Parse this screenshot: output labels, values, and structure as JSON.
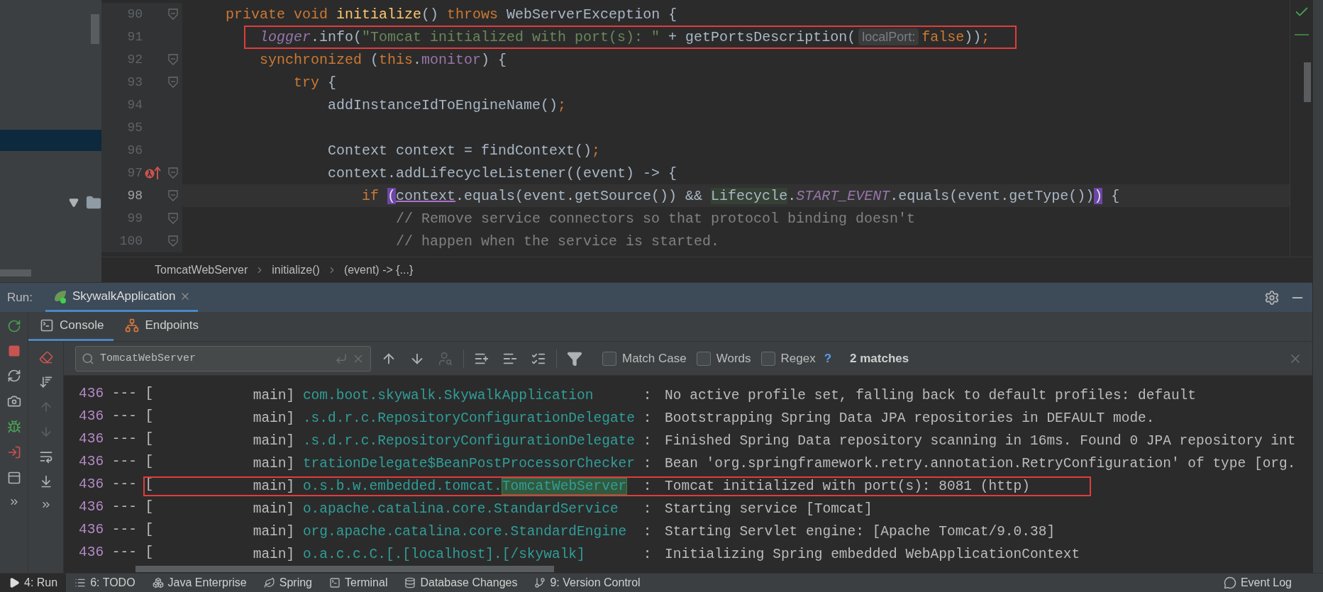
{
  "project_panel": {
    "rows": [
      {
        "kind": "blank",
        "selected": true
      },
      {
        "kind": "folder",
        "selected": false,
        "expanded": true
      }
    ]
  },
  "code": {
    "lines": [
      {
        "number": "90",
        "foldable": true,
        "current": false,
        "boxed": false,
        "tokens": [
          {
            "kind": "keyword",
            "text": "private void "
          },
          {
            "kind": "method_decl",
            "text": "initialize"
          },
          {
            "kind": "plain",
            "text": "() "
          },
          {
            "kind": "keyword",
            "text": "throws"
          },
          {
            "kind": "plain",
            "text": " WebServerException {"
          }
        ],
        "children": [
          {
            "number": "91",
            "foldable": false,
            "current": false,
            "boxed": true,
            "tokens": [
              {
                "kind": "field_italic",
                "text": "logger"
              },
              {
                "kind": "plain",
                "text": ".info("
              },
              {
                "kind": "string",
                "text": "\"Tomcat initialized with port(s): \""
              },
              {
                "kind": "plain",
                "text": " + getPortsDescription("
              },
              {
                "kind": "hint",
                "text": "localPort:"
              },
              {
                "kind": "keyword",
                "text": "false"
              },
              {
                "kind": "plain",
                "text": "))"
              },
              {
                "kind": "keyword",
                "text": ";"
              }
            ]
          },
          {
            "number": "92",
            "foldable": true,
            "current": false,
            "boxed": false,
            "tokens": [
              {
                "kind": "keyword",
                "text": "synchronized"
              },
              {
                "kind": "plain",
                "text": " ("
              },
              {
                "kind": "keyword",
                "text": "this"
              },
              {
                "kind": "plain",
                "text": "."
              },
              {
                "kind": "field",
                "text": "monitor"
              },
              {
                "kind": "plain",
                "text": ") {"
              }
            ],
            "children": [
              {
                "number": "93",
                "foldable": true,
                "current": false,
                "boxed": false,
                "tokens": [
                  {
                    "kind": "keyword",
                    "text": "try"
                  },
                  {
                    "kind": "plain",
                    "text": " {"
                  }
                ],
                "children": [
                  {
                    "number": "94",
                    "foldable": false,
                    "current": false,
                    "boxed": false,
                    "tokens": [
                      {
                        "kind": "plain",
                        "text": "addInstanceIdToEngineName()"
                      },
                      {
                        "kind": "keyword",
                        "text": ";"
                      }
                    ]
                  },
                  {
                    "number": "95",
                    "foldable": false,
                    "current": false
                  },
                  {
                    "number": "96",
                    "foldable": false,
                    "current": false,
                    "boxed": false,
                    "tokens": [
                      {
                        "kind": "plain",
                        "text": "Context context = findContext()"
                      },
                      {
                        "kind": "keyword",
                        "text": ";"
                      }
                    ]
                  },
                  {
                    "number": "97",
                    "foldable": true,
                    "current": false,
                    "boxed": false,
                    "kind": "lambda",
                    "tokens": [
                      {
                        "kind": "plain",
                        "text": "context.addLifecycleListener((event) -> {"
                      }
                    ],
                    "children": [
                      {
                        "number": "98",
                        "foldable": true,
                        "current": true,
                        "boxed": false,
                        "tokens": [
                          {
                            "kind": "keyword",
                            "text": "if "
                          },
                          {
                            "kind": "brace",
                            "text": "("
                          },
                          {
                            "kind": "captured",
                            "text": "context"
                          },
                          {
                            "kind": "plain",
                            "text": ".equals(event.getSource()) && "
                          },
                          {
                            "kind": "usage",
                            "text": "Lifecycle"
                          },
                          {
                            "kind": "plain",
                            "text": "."
                          },
                          {
                            "kind": "static",
                            "text": "START_EVENT"
                          },
                          {
                            "kind": "plain",
                            "text": ".equals(event.getType())"
                          },
                          {
                            "kind": "brace",
                            "text": ")"
                          },
                          {
                            "kind": "plain",
                            "text": " {"
                          }
                        ],
                        "children": [
                          {
                            "number": "99",
                            "foldable": true,
                            "current": false,
                            "boxed": false,
                            "tokens": [
                              {
                                "kind": "comment",
                                "text": "// Remove service connectors so that protocol binding doesn't"
                              }
                            ]
                          },
                          {
                            "number": "100",
                            "foldable": true,
                            "current": false,
                            "boxed": false,
                            "tokens": [
                              {
                                "kind": "comment",
                                "text": "// happen when the service is started."
                              }
                            ]
                          }
                        ]
                      }
                    ]
                  }
                ]
              }
            ]
          }
        ]
      }
    ]
  },
  "breadcrumbs": [
    "TomcatWebServer",
    "initialize()",
    "(event) -> {...}"
  ],
  "run": {
    "label": "Run:",
    "tabs": [
      {
        "label": "SkywalkApplication",
        "selected": true
      }
    ]
  },
  "run_toolbar": [
    {
      "kind": "rerun"
    },
    {
      "kind": "stop"
    },
    {
      "kind": "restore"
    },
    {
      "kind": "screenshot"
    },
    {
      "kind": "debug"
    },
    {
      "kind": "exit"
    },
    {
      "kind": "layout"
    },
    {
      "kind": "more"
    }
  ],
  "console_tabs": [
    {
      "label": "Console",
      "kind": "console",
      "selected": true
    },
    {
      "label": "Endpoints",
      "kind": "endpoints",
      "selected": false
    }
  ],
  "side_toolbar": [
    {
      "kind": "eraser",
      "disabled": false
    },
    {
      "kind": "sort",
      "disabled": false
    },
    {
      "kind": "up",
      "disabled": true
    },
    {
      "kind": "down",
      "disabled": true
    },
    {
      "kind": "wrap",
      "disabled": false
    },
    {
      "kind": "scroll-end",
      "disabled": false
    },
    {
      "kind": "more",
      "disabled": false
    }
  ],
  "search": {
    "value": "TomcatWebServer",
    "tools": [
      {
        "kind": "up",
        "disabled": false
      },
      {
        "kind": "down",
        "disabled": false
      },
      {
        "kind": "usage",
        "disabled": true
      },
      {
        "kind": "add",
        "disabled": false
      },
      {
        "kind": "remove",
        "disabled": false
      },
      {
        "kind": "select",
        "disabled": false
      },
      {
        "kind": "filter",
        "disabled": false
      }
    ],
    "options": [
      {
        "label": "Match Case",
        "checked": false
      },
      {
        "label": "Words",
        "checked": false
      },
      {
        "label": "Regex",
        "checked": false
      }
    ],
    "help": "?",
    "matches": "2 matches"
  },
  "console": {
    "rows": [
      {
        "pid": "436",
        "sep": "--- [",
        "thread": "main]",
        "logger": [
          {
            "text": "com.boot.skywalk.SkywalkApplication",
            "match": false
          }
        ],
        "colon": ":",
        "message": "No active profile set, falling back to default profiles: default",
        "boxed": false
      },
      {
        "pid": "436",
        "sep": "--- [",
        "thread": "main]",
        "logger": [
          {
            "text": ".s.d.r.c.RepositoryConfigurationDelegate",
            "match": false
          }
        ],
        "colon": ":",
        "message": "Bootstrapping Spring Data JPA repositories in DEFAULT mode.",
        "boxed": false
      },
      {
        "pid": "436",
        "sep": "--- [",
        "thread": "main]",
        "logger": [
          {
            "text": ".s.d.r.c.RepositoryConfigurationDelegate",
            "match": false
          }
        ],
        "colon": ":",
        "message": "Finished Spring Data repository scanning in 16ms. Found 0 JPA repository int",
        "boxed": false
      },
      {
        "pid": "436",
        "sep": "--- [",
        "thread": "main]",
        "logger": [
          {
            "text": "trationDelegate$BeanPostProcessorChecker",
            "match": false
          }
        ],
        "colon": ":",
        "message": "Bean 'org.springframework.retry.annotation.RetryConfiguration' of type [org.",
        "boxed": false
      },
      {
        "pid": "436",
        "sep": "--- [",
        "thread": "main]",
        "logger": [
          {
            "text": "o.s.b.w.embedded.tomcat.",
            "match": false
          },
          {
            "text": "TomcatWebServer",
            "match": true
          }
        ],
        "colon": ":",
        "message": "Tomcat initialized with port(s): 8081 (http)",
        "boxed": true
      },
      {
        "pid": "436",
        "sep": "--- [",
        "thread": "main]",
        "logger": [
          {
            "text": "o.apache.catalina.core.StandardService",
            "match": false
          }
        ],
        "colon": ":",
        "message": "Starting service [Tomcat]",
        "boxed": false
      },
      {
        "pid": "436",
        "sep": "--- [",
        "thread": "main]",
        "logger": [
          {
            "text": "org.apache.catalina.core.StandardEngine",
            "match": false
          }
        ],
        "colon": ":",
        "message": "Starting Servlet engine: [Apache Tomcat/9.0.38]",
        "boxed": false
      },
      {
        "pid": "436",
        "sep": "--- [",
        "thread": "main]",
        "logger": [
          {
            "text": "o.a.c.c.C.[.[localhost].[/skywalk]",
            "match": false
          }
        ],
        "colon": ":",
        "message": "Initializing Spring embedded WebApplicationContext",
        "boxed": false
      }
    ]
  },
  "status_bar": {
    "items": [
      {
        "label": "4: Run",
        "kind": "run",
        "selected": true
      },
      {
        "label": "6: TODO",
        "kind": "todo",
        "selected": false
      },
      {
        "label": "Java Enterprise",
        "kind": "enterprise",
        "selected": false
      },
      {
        "label": "Spring",
        "kind": "spring",
        "selected": false
      },
      {
        "label": "Terminal",
        "kind": "terminal",
        "selected": false
      },
      {
        "label": "Database Changes",
        "kind": "database",
        "selected": false
      },
      {
        "label": "9: Version Control",
        "kind": "vcs",
        "selected": false
      }
    ],
    "right": {
      "label": "Event Log"
    }
  }
}
